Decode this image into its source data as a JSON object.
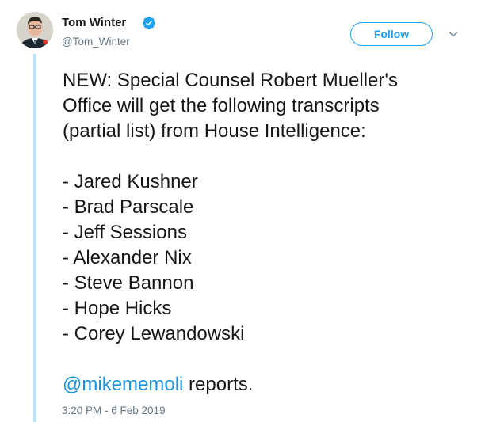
{
  "author": {
    "name": "Tom Winter",
    "handle": "@Tom_Winter",
    "verified": true
  },
  "follow_label": "Follow",
  "tweet": {
    "intro_lines": [
      "NEW: Special Counsel Robert Mueller's",
      "Office will get the following transcripts",
      "(partial list) from House Intelligence:"
    ],
    "list_items": [
      "- Jared Kushner",
      "- Brad Parscale",
      "- Jeff Sessions",
      "- Alexander Nix",
      "- Steve Bannon",
      "- Hope Hicks",
      "- Corey Lewandowski"
    ],
    "mention": "@mikememoli",
    "mention_suffix": " reports."
  },
  "timestamp": "3:20 PM - 6 Feb 2019",
  "colors": {
    "accent": "#1da1f2",
    "link": "#1b95e0",
    "thread_line": "#b9e3f6",
    "secondary_text": "#657786"
  },
  "icons": [
    "verified-badge-icon",
    "chevron-down-icon"
  ]
}
